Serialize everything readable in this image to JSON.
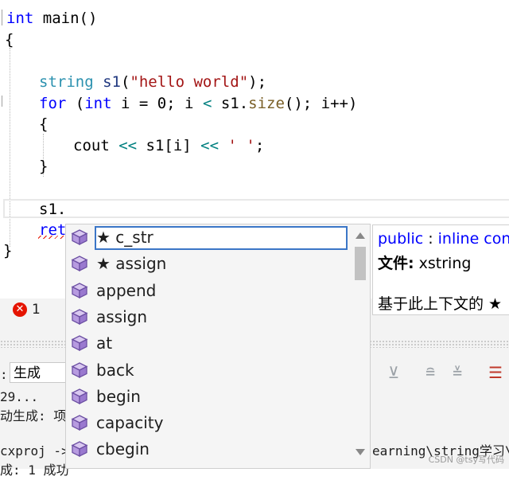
{
  "code": {
    "line1_kw": "int",
    "line1_rest": " main()",
    "line2": "{",
    "line3_type": "string",
    "line3_var": " s1",
    "line3_open": "(",
    "line3_str": "\"hello world\"",
    "line3_close": ");",
    "line4_for": "for",
    "line4_a": " (",
    "line4_int": "int",
    "line4_b": " i = 0; i ",
    "line4_lt": "<",
    "line4_c": " s1.",
    "line4_fn": "size",
    "line4_d": "(); i++)",
    "line5": "{",
    "line6_cout": "cout ",
    "line6_op1": "<<",
    "line6_s1": " s1[i] ",
    "line6_op2": "<<",
    "line6_str": " ' '",
    "line6_end": ";",
    "line7": "}",
    "line8": "s1.",
    "line9": "ret",
    "line10": "}"
  },
  "errors": {
    "icon": "error-circle-icon",
    "count": "1"
  },
  "output": {
    "config": "生成",
    "line1": "29...",
    "line2": "动生成: 项",
    "line3": "cxproj ->",
    "line3_right": "earning\\string学习\\x",
    "line4": "成: 1 成功"
  },
  "autocomplete": {
    "items": [
      "★ c_str",
      "★ assign",
      "append",
      "assign",
      "at",
      "back",
      "begin",
      "capacity",
      "cbegin"
    ],
    "selected_index": 0,
    "item_icon": "member-cube-icon"
  },
  "tooltip": {
    "l1_kw": "public",
    "l1_sep": " : ",
    "l1_rest": "inline con",
    "l2_label": "文件:",
    "l2_value": " xstring",
    "l3": "基于此上下文的 ★"
  },
  "watermark": "CSDN @tsy写代码"
}
